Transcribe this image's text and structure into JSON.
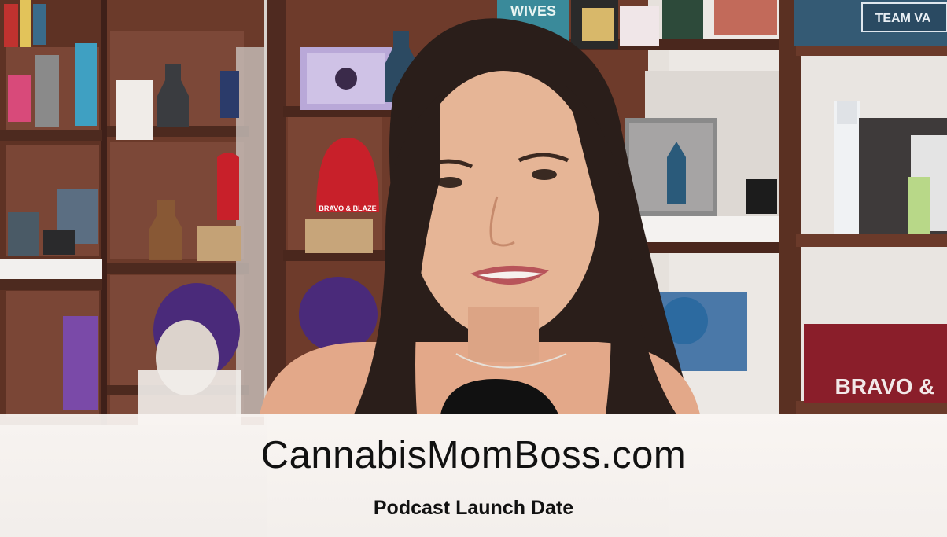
{
  "lower_third": {
    "title": "CannabisMomBoss.com",
    "subtitle": "Podcast Launch Date"
  },
  "background_text": {
    "wives": "WIVES",
    "team": "TEAM VA",
    "bravo": "BRAVO &",
    "beanie": "BRAVO & BLAZE"
  },
  "colors": {
    "shelf_wood": "#6b3a2a",
    "wall": "#e8e4df",
    "beanie_red": "#c8202a",
    "bag_red": "#8a1e2a",
    "hair": "#2a1e1a",
    "skin": "#e3b08f",
    "caption_bg": "#f6f2ef",
    "caption_text": "#111111"
  }
}
